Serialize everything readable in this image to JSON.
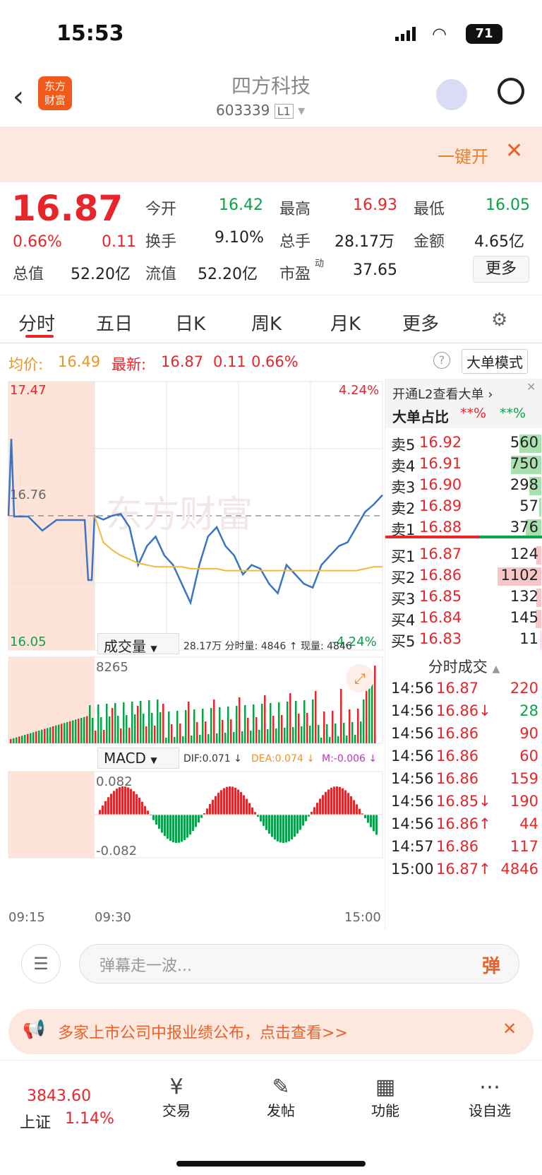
{
  "status": {
    "time": "15:53",
    "battery": "71"
  },
  "nav": {
    "logo": "东方\n财富",
    "title": "四方科技",
    "code": "603339",
    "level": "L1"
  },
  "banner": {
    "text": "一键开"
  },
  "quote": {
    "price": "16.87",
    "pct": "0.66%",
    "chg": "0.11",
    "open_l": "今开",
    "open": "16.42",
    "high_l": "最高",
    "high": "16.93",
    "low_l": "最低",
    "low": "16.05",
    "turn_l": "换手",
    "turn": "9.10%",
    "vol_l": "总手",
    "vol": "28.17万",
    "amt_l": "金额",
    "amt": "4.65亿",
    "mv_l": "总值",
    "mv": "52.20亿",
    "fv_l": "流值",
    "fv": "52.20亿",
    "pe_l": "市盈",
    "pe_sup": "动",
    "pe": "37.65",
    "more": "更多"
  },
  "tabs": [
    "分时",
    "五日",
    "日K",
    "周K",
    "月K",
    "更多",
    "⚙"
  ],
  "info": {
    "avg_l": "均价:",
    "avg": "16.49",
    "last_l": "最新:",
    "last": "16.87",
    "chg": "0.11",
    "pct": "0.66%",
    "mode": "大单模式"
  },
  "chart_labels": {
    "ymax": "17.47",
    "ymin": "16.05",
    "pmax": "4.24%",
    "pmin": "-4.24%",
    "ref": "16.76",
    "vol_sel": "成交量",
    "vol_info": "28.17万 分时量: 4846 ↑ 现量: 4846",
    "vol_max": "8265",
    "macd_sel": "MACD",
    "dif": "DIF:0.071 ↓",
    "dea": "DEA:0.074 ↓",
    "m": "M:-0.006 ↓",
    "macd_max": "0.082",
    "macd_min": "-0.082",
    "t1": "09:15",
    "t2": "09:30",
    "t3": "15:00",
    "watermark": "东方财富"
  },
  "book": {
    "l2": "开通L2查看大单 ›",
    "ratio_l": "大单占比",
    "r1": "**%",
    "r2": "**%",
    "asks": [
      [
        "卖5",
        "16.92",
        "560",
        0.5
      ],
      [
        "卖4",
        "16.91",
        "750",
        0.7
      ],
      [
        "卖3",
        "16.90",
        "298",
        0.28
      ],
      [
        "卖2",
        "16.89",
        "57",
        0.05
      ],
      [
        "卖1",
        "16.88",
        "376",
        0.35
      ]
    ],
    "bids": [
      [
        "买1",
        "16.87",
        "124",
        0.12
      ],
      [
        "买2",
        "16.86",
        "1102",
        1.0
      ],
      [
        "买3",
        "16.85",
        "132",
        0.12
      ],
      [
        "买4",
        "16.84",
        "145",
        0.13
      ],
      [
        "买5",
        "16.83",
        "11",
        0.02
      ]
    ],
    "trades_title": "分时成交",
    "trades": [
      [
        "14:56",
        "16.87",
        "",
        "220"
      ],
      [
        "14:56",
        "16.86",
        "↓",
        "28"
      ],
      [
        "14:56",
        "16.86",
        "",
        "90"
      ],
      [
        "14:56",
        "16.86",
        "",
        "60"
      ],
      [
        "14:56",
        "16.86",
        "",
        "159"
      ],
      [
        "14:56",
        "16.85",
        "↓",
        "190"
      ],
      [
        "14:56",
        "16.86",
        "↑",
        "44"
      ],
      [
        "14:57",
        "16.86",
        "",
        "117"
      ],
      [
        "15:00",
        "16.87",
        "↑",
        "4846"
      ]
    ]
  },
  "comment": {
    "placeholder": "弹幕走一波...",
    "btn": "弹"
  },
  "notice": {
    "text": "多家上市公司中报业绩公布，点击查看>>"
  },
  "bottom": {
    "index": "3843.60",
    "idx_name": "上证",
    "idx_pct": "1.14%",
    "trade": "交易",
    "post": "发帖",
    "func": "功能",
    "watch": "设自选"
  },
  "chart_data": {
    "type": "line",
    "series": [
      {
        "values": [
          16.76,
          16.74,
          16.76,
          16.77,
          16.7,
          16.5,
          16.6,
          16.65,
          16.55,
          16.5,
          16.4,
          16.3,
          16.5,
          16.65,
          16.7,
          16.6,
          16.55,
          16.45,
          16.5,
          16.48,
          16.4,
          16.35,
          16.5,
          16.45,
          16.4,
          16.38,
          16.5,
          16.55,
          16.6,
          16.62,
          16.7,
          16.78,
          16.82,
          16.87
        ]
      },
      {
        "values": [
          16.76,
          16.62,
          16.58,
          16.55,
          16.53,
          16.51,
          16.5,
          16.49,
          16.49,
          16.49,
          16.49,
          16.48,
          16.48,
          16.48,
          16.48,
          16.47,
          16.47,
          16.47,
          16.47,
          16.47,
          16.47,
          16.47,
          16.47,
          16.47,
          16.47,
          16.47,
          16.47,
          16.47,
          16.47,
          16.47,
          16.47,
          16.48,
          16.49,
          16.49
        ]
      }
    ],
    "ylim": [
      16.05,
      17.47
    ]
  }
}
